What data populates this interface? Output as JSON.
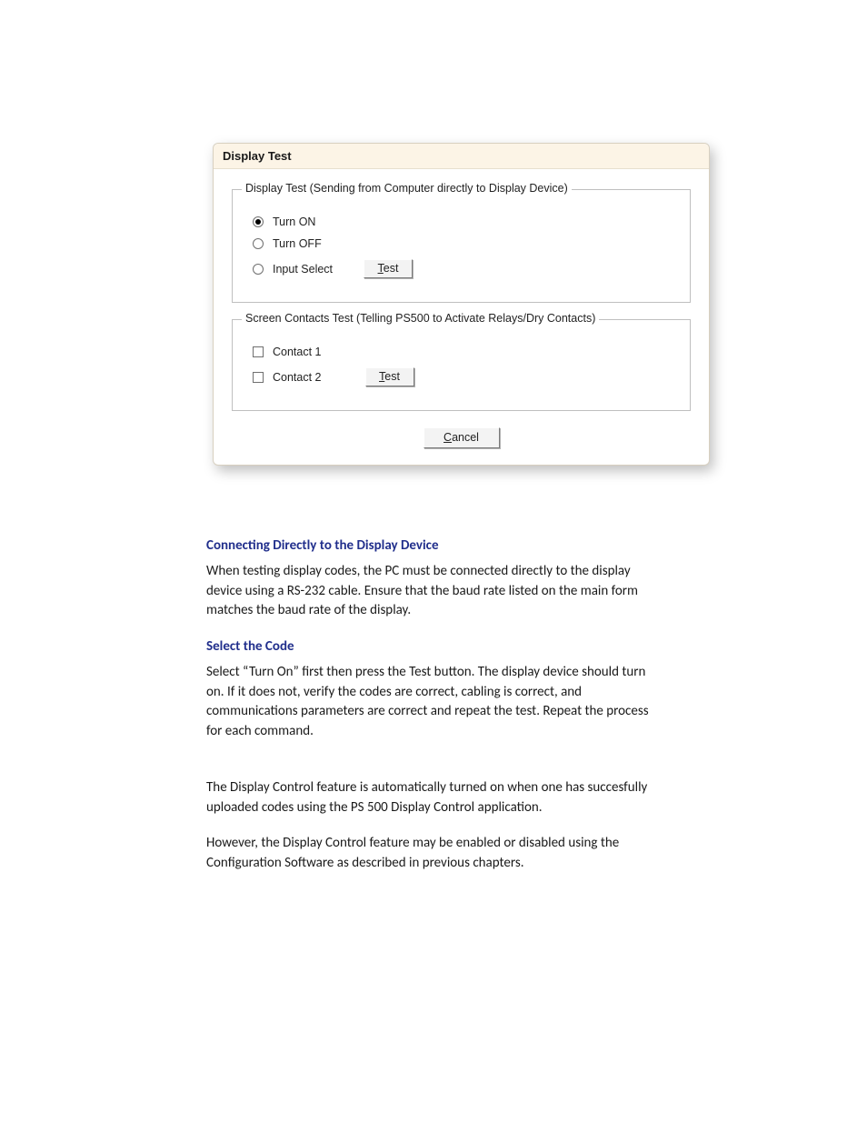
{
  "dialog": {
    "title": "Display Test",
    "group1": {
      "legend": "Display Test (Sending from Computer directly to Display Device)",
      "options": {
        "turn_on": "Turn ON",
        "turn_off": "Turn OFF",
        "input_select": "Input Select"
      },
      "selected": "turn_on",
      "test_prefix": "T",
      "test_rest": "est"
    },
    "group2": {
      "legend": "Screen Contacts Test (Telling PS500 to Activate Relays/Dry Contacts)",
      "contacts": {
        "c1": "Contact 1",
        "c2": "Contact 2"
      },
      "test_prefix": "T",
      "test_rest": "est"
    },
    "cancel_prefix": "C",
    "cancel_rest": "ancel"
  },
  "headings": {
    "h1": "Connecting Directly to the Display Device",
    "h2": "Select the Code"
  },
  "paragraphs": {
    "p1": "When testing display codes, the PC must be connected directly to the display device using a RS-232 cable. Ensure that the baud rate listed on the main form matches the baud rate of the display.",
    "p2": "Select “Turn On” first then press the Test button. The display device should turn on. If it does not, verify the codes are correct, cabling is correct, and communications parameters are correct and repeat the test.  Repeat the process for each command.",
    "p3": "The Display Control feature is automatically turned on when one has succesfully uploaded codes using the PS 500 Display Control application.",
    "p4": "However, the Display Control feature may be enabled or disabled using the Configuration Software as described in previous chapters."
  }
}
